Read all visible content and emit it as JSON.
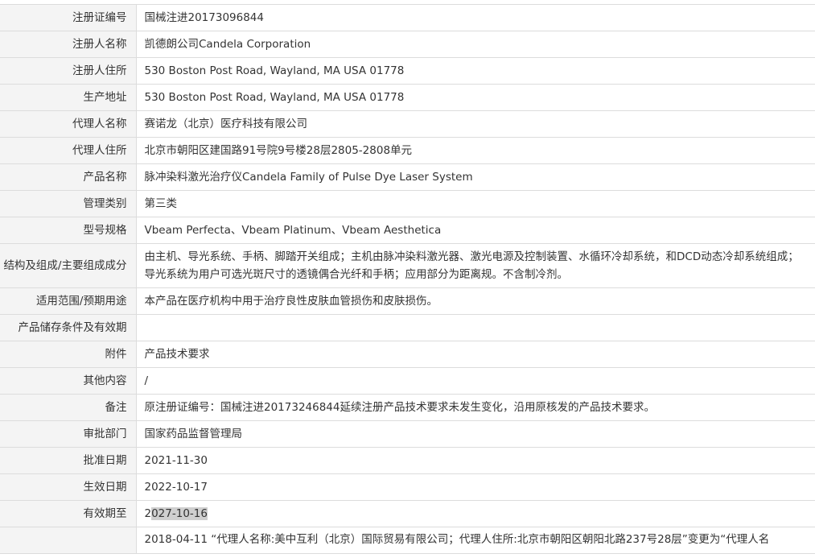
{
  "rows": [
    {
      "label": "注册证编号",
      "value": "国械注进20173096844"
    },
    {
      "label": "注册人名称",
      "value": "凯德朗公司Candela Corporation"
    },
    {
      "label": "注册人住所",
      "value": "530 Boston Post Road, Wayland, MA USA 01778"
    },
    {
      "label": "生产地址",
      "value": "530 Boston Post Road, Wayland, MA USA 01778"
    },
    {
      "label": "代理人名称",
      "value": "赛诺龙（北京）医疗科技有限公司"
    },
    {
      "label": "代理人住所",
      "value": "北京市朝阳区建国路91号院9号楼28层2805-2808单元"
    },
    {
      "label": "产品名称",
      "value": "脉冲染料激光治疗仪Candela Family of Pulse Dye Laser System"
    },
    {
      "label": "管理类别",
      "value": "第三类"
    },
    {
      "label": "型号规格",
      "value": "Vbeam Perfecta、Vbeam Platinum、Vbeam Aesthetica"
    },
    {
      "label": "结构及组成/主要组成成分",
      "value": "由主机、导光系统、手柄、脚踏开关组成；主机由脉冲染料激光器、激光电源及控制装置、水循环冷却系统，和DCD动态冷却系统组成；导光系统为用户可选光斑尺寸的透镜偶合光纤和手柄；应用部分为距离规。不含制冷剂。"
    },
    {
      "label": "适用范围/预期用途",
      "value": "本产品在医疗机构中用于治疗良性皮肤血管损伤和皮肤损伤。"
    },
    {
      "label": "产品储存条件及有效期",
      "value": ""
    },
    {
      "label": "附件",
      "value": "产品技术要求"
    },
    {
      "label": "其他内容",
      "value": "/"
    },
    {
      "label": "备注",
      "value": "原注册证编号：国械注进20173246844延续注册产品技术要求未发生变化，沿用原核发的产品技术要求。"
    },
    {
      "label": "审批部门",
      "value": "国家药品监督管理局"
    },
    {
      "label": "批准日期",
      "value": "2021-11-30"
    },
    {
      "label": "生效日期",
      "value": "2022-10-17"
    },
    {
      "label": "有效期至",
      "value_prefix": "2",
      "value_selected": "027-10-16"
    },
    {
      "label": "",
      "value": "2018-04-11 “代理人名称:美中互利（北京）国际贸易有限公司；代理人住所:北京市朝阳区朝阳北路237号28层”变更为“代理人名"
    }
  ]
}
